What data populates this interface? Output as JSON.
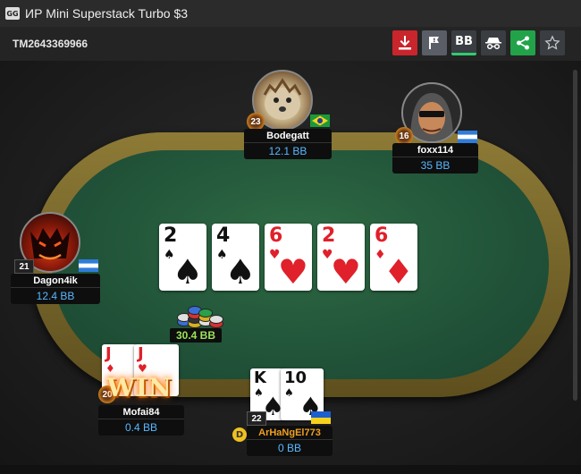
{
  "window": {
    "app_badge": "GG",
    "title": "ИР  Mini Superstack Turbo $3"
  },
  "header": {
    "tournament_id": "TM2643369966"
  },
  "toolbar": {
    "download_icon": "download-icon",
    "report_icon": "flag-report-icon",
    "bb_label": "BB",
    "spy_icon": "incognito-icon",
    "share_icon": "share-icon",
    "favorite_icon": "star-icon"
  },
  "board": {
    "cards": [
      {
        "rank": "2",
        "suit": "♠",
        "color": "black"
      },
      {
        "rank": "4",
        "suit": "♠",
        "color": "black"
      },
      {
        "rank": "6",
        "suit": "♥",
        "color": "red"
      },
      {
        "rank": "2",
        "suit": "♥",
        "color": "red"
      },
      {
        "rank": "6",
        "suit": "♦",
        "color": "red"
      }
    ]
  },
  "pot": {
    "amount": "30.4 BB"
  },
  "players": {
    "bodegatt": {
      "name": "Bodegatt",
      "stack": "12.1 BB",
      "level": "23",
      "flag": "brazil"
    },
    "foxx114": {
      "name": "foxx114",
      "stack": "35 BB",
      "level": "16",
      "flag": "honduras"
    },
    "dagon4ik": {
      "name": "Dagon4ik",
      "stack": "12.4 BB",
      "level": "21",
      "flag": "honduras"
    },
    "mofai84": {
      "name": "Mofai84",
      "stack": "0.4 BB",
      "level": "20",
      "win_text": "WIN",
      "cards": [
        {
          "rank": "J",
          "suit": "♦",
          "color": "red"
        },
        {
          "rank": "J",
          "suit": "♥",
          "color": "red"
        }
      ]
    },
    "hero": {
      "name": "ArHaNgEl773",
      "stack": "0 BB",
      "level": "22",
      "flag": "ukraine",
      "dealer": "D",
      "cards": [
        {
          "rank": "K",
          "suit": "♠",
          "color": "black"
        },
        {
          "rank": "10",
          "suit": "♠",
          "color": "black"
        }
      ]
    }
  },
  "colors": {
    "felt": "#22553a",
    "rail": "#8d7a36",
    "stack_text": "#58b8ff",
    "pot_text": "#9be35a",
    "hero_name": "#f0a020"
  }
}
